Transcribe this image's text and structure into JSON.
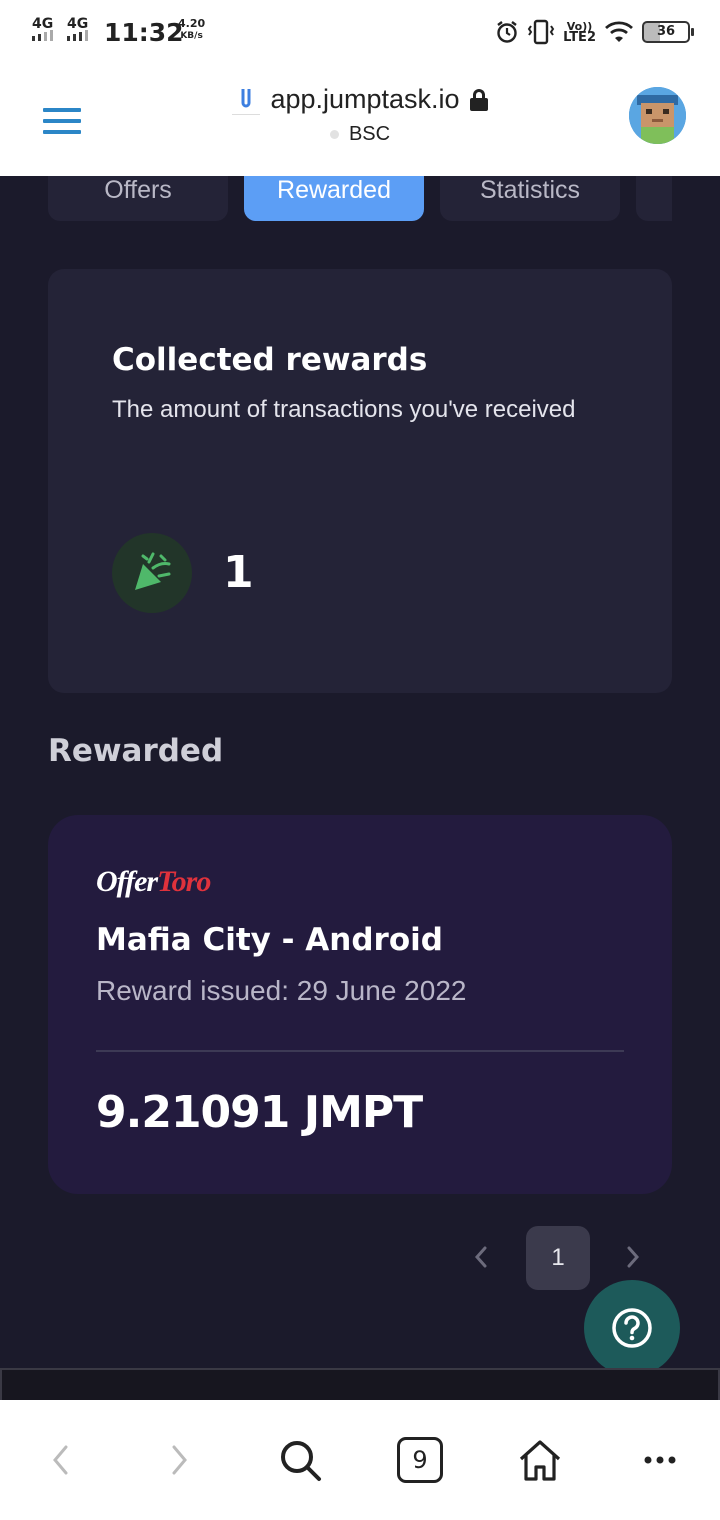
{
  "status_bar": {
    "net1": "4G",
    "net2": "4G",
    "time": "11:32",
    "speed_value": "4.20",
    "speed_unit": "KB/s",
    "lte_top": "Vo))",
    "lte_bottom": "LTE2",
    "battery": "36"
  },
  "browser": {
    "url": "app.jumptask.io",
    "network": "BSC",
    "open_tabs": "9"
  },
  "tabs": [
    {
      "label": "Offers"
    },
    {
      "label": "Rewarded"
    },
    {
      "label": "Statistics"
    }
  ],
  "collected": {
    "title": "Collected rewards",
    "subtitle": "The amount of transactions you've received",
    "count": "1"
  },
  "section_title": "Rewarded",
  "reward": {
    "provider_a": "Offer",
    "provider_b": "Toro",
    "title": "Mafia City - Android",
    "date": "Reward issued: 29 June 2022",
    "amount": "9.21091 JMPT"
  },
  "pagination": {
    "current": "1"
  },
  "colors": {
    "background": "#1b1a2b",
    "card": "#242337",
    "active_tab": "#5c9ef5",
    "reward_card": "#231b3e",
    "help_button": "#1d5a5a",
    "menu_icon": "#2b86c7"
  }
}
